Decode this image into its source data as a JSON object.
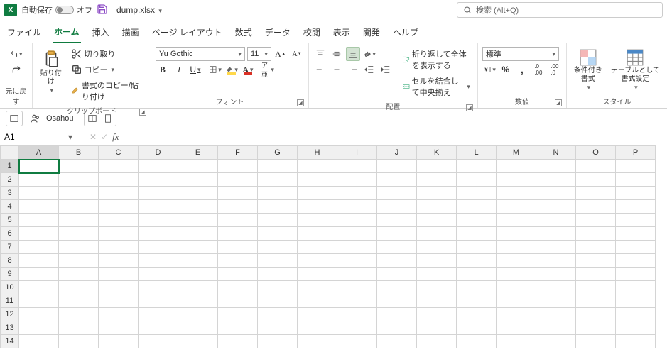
{
  "title": {
    "autosave_label": "自動保存",
    "autosave_state": "オフ",
    "filename": "dump.xlsx",
    "search_placeholder": "検索 (Alt+Q)"
  },
  "tabs": {
    "file": "ファイル",
    "home": "ホーム",
    "insert": "挿入",
    "draw": "描画",
    "pagelayout": "ページ レイアウト",
    "formulas": "数式",
    "data": "データ",
    "review": "校閲",
    "view": "表示",
    "developer": "開発",
    "help": "ヘルプ"
  },
  "ribbon": {
    "undo_group": "元に戻す",
    "clipboard": {
      "label": "クリップボード",
      "paste": "貼り付け",
      "cut": "切り取り",
      "copy": "コピー",
      "format_painter": "書式のコピー/貼り付け"
    },
    "font": {
      "label": "フォント",
      "name": "Yu Gothic",
      "size": "11",
      "bold": "B",
      "italic": "I",
      "underline": "U",
      "increase": "A",
      "decrease": "A"
    },
    "align": {
      "label": "配置",
      "wrap": "折り返して全体を表示する",
      "merge": "セルを結合して中央揃え"
    },
    "number": {
      "label": "数値",
      "format": "標準"
    },
    "styles": {
      "label": "スタイル",
      "cond": "条件付き\n書式",
      "table": "テーブルとして\n書式設定"
    }
  },
  "qat": {
    "team_name": "Osahou"
  },
  "formula": {
    "cell_ref": "A1",
    "value": ""
  },
  "grid": {
    "cols": [
      "A",
      "B",
      "C",
      "D",
      "E",
      "F",
      "G",
      "H",
      "I",
      "J",
      "K",
      "L",
      "M",
      "N",
      "O",
      "P"
    ],
    "rows": [
      1,
      2,
      3,
      4,
      5,
      6,
      7,
      8,
      9,
      10,
      11,
      12,
      13,
      14
    ],
    "active": "A1"
  }
}
